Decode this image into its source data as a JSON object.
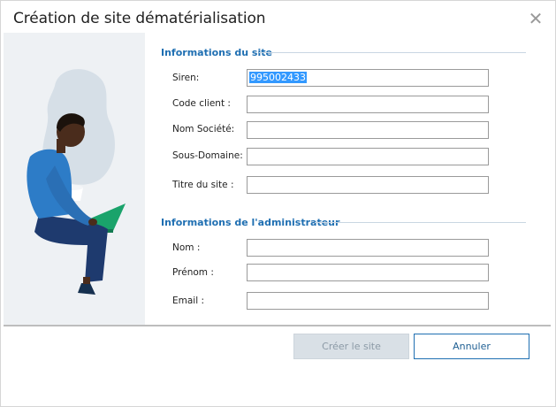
{
  "dialog": {
    "title": "Création de site dématérialisation",
    "close_icon": "close-icon"
  },
  "section_site": {
    "title": "Informations du site",
    "fields": [
      {
        "label": "Siren:",
        "value": "995002433"
      },
      {
        "label": "Code client :",
        "value": ""
      },
      {
        "label": "Nom Société:",
        "value": ""
      },
      {
        "label": "Sous-Domaine:",
        "value": ""
      },
      {
        "label": "Titre du site :",
        "value": ""
      }
    ]
  },
  "section_admin": {
    "title": "Informations de l'administrateur",
    "fields": [
      {
        "label": "Nom :",
        "value": ""
      },
      {
        "label": "Prénom :",
        "value": ""
      },
      {
        "label": "Email :",
        "value": ""
      }
    ]
  },
  "buttons": {
    "create": "Créer le site",
    "cancel": "Annuler"
  },
  "colors": {
    "accent": "#1f6fb2",
    "panel_bg": "#eef1f4",
    "disabled_btn": "#d9e0e6",
    "selection": "#3399ff"
  },
  "illustration": "person-with-laptop-illustration"
}
